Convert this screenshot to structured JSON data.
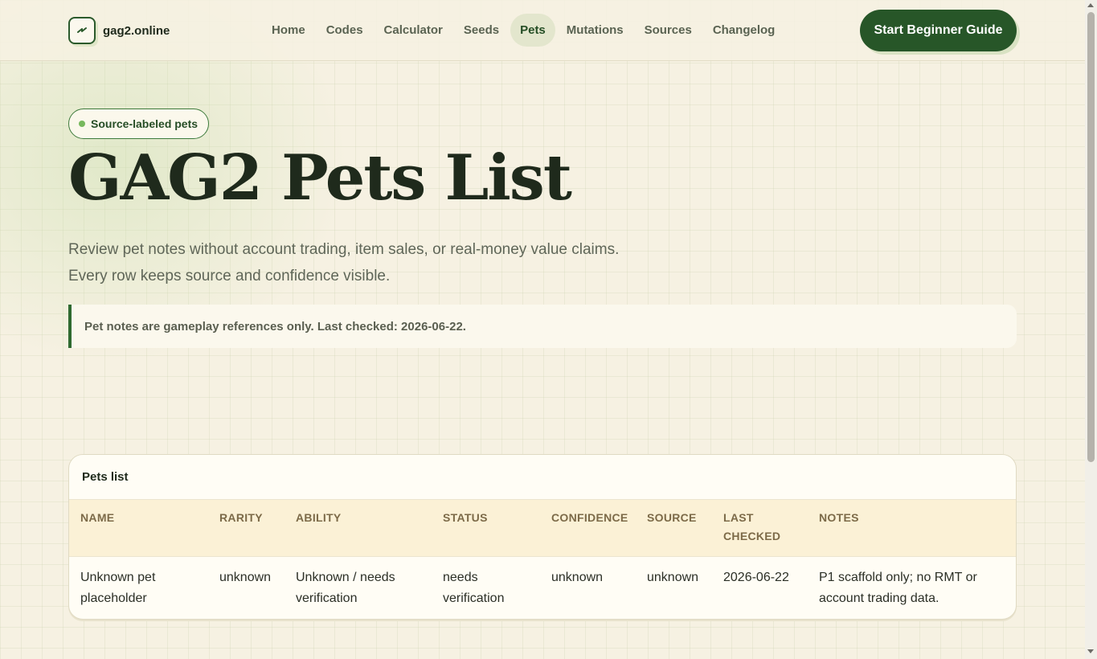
{
  "header": {
    "brand_name": "gag2.online",
    "logo_icon": "lightning-icon",
    "nav": [
      {
        "label": "Home"
      },
      {
        "label": "Codes"
      },
      {
        "label": "Calculator"
      },
      {
        "label": "Seeds"
      },
      {
        "label": "Pets",
        "active": true
      },
      {
        "label": "Mutations"
      },
      {
        "label": "Sources"
      },
      {
        "label": "Changelog"
      }
    ],
    "cta_label": "Start Beginner Guide"
  },
  "hero": {
    "badge": "Source-labeled pets",
    "title": "GAG2 Pets List",
    "subtitle_line1": "Review pet notes without account trading, item sales, or real-money value claims.",
    "subtitle_line2": "Every row keeps source and confidence visible.",
    "notice": "Pet notes are gameplay references only. Last checked: 2026-06-22."
  },
  "table": {
    "title": "Pets list",
    "columns": [
      "NAME",
      "RARITY",
      "ABILITY",
      "STATUS",
      "CONFIDENCE",
      "SOURCE",
      "LAST CHECKED",
      "NOTES"
    ],
    "rows": [
      [
        "Unknown pet placeholder",
        "unknown",
        "Unknown / needs verification",
        "needs verification",
        "unknown",
        "unknown",
        "2026-06-22",
        "P1 scaffold only; no RMT or account trading data."
      ]
    ]
  },
  "colors": {
    "accent": "#275628",
    "background": "#f6f1e2",
    "table_header_bg": "#fbf1d6"
  }
}
